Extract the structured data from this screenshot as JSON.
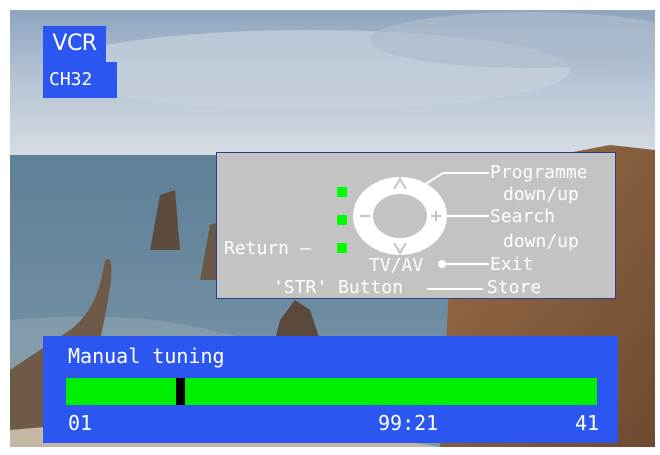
{
  "osd": {
    "mode_label": "VCR",
    "channel_label": "CH32"
  },
  "remote_help": {
    "programme": "Programme",
    "programme_sub": "down/up",
    "search": "Search",
    "search_sub": "down/up",
    "return": "Return –",
    "tvav": "TV/AV",
    "exit": "Exit",
    "str_button": "'STR' Button",
    "store": "Store",
    "colors": {
      "panel": "#c3c3c3",
      "indicator": "#00ff00",
      "text": "#ffffff"
    }
  },
  "tuning": {
    "title": "Manual tuning",
    "start_value": "01",
    "frequency": "99:21",
    "end_value": "41",
    "progress_fraction": 0.21,
    "colors": {
      "panel": "#2b56f0",
      "bar": "#00ee00",
      "marker": "#000000"
    }
  },
  "icons": [
    "remote-dpad-icon",
    "indicator-square-icon",
    "exit-dot-icon"
  ]
}
